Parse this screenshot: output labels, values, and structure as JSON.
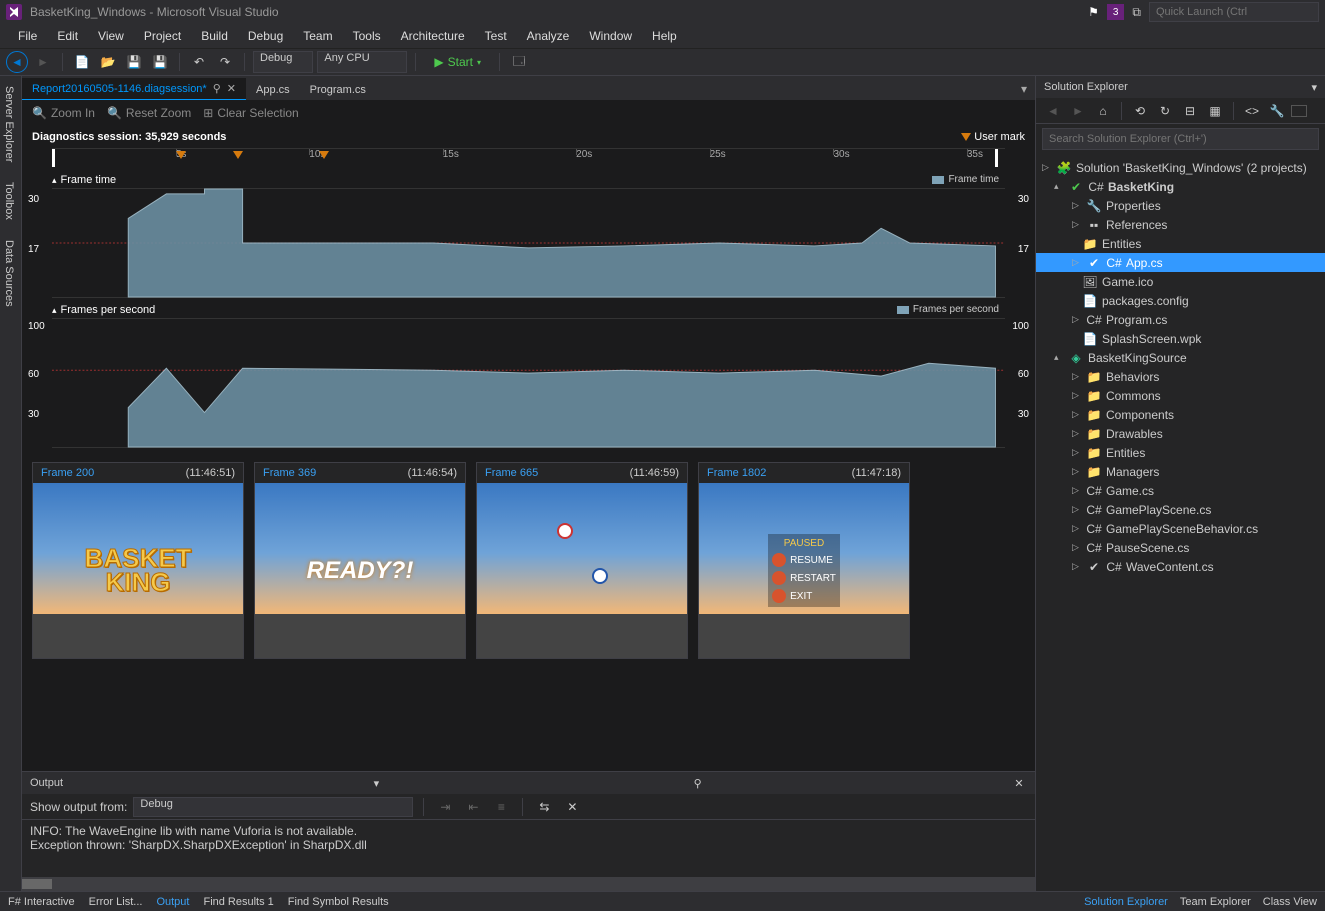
{
  "title": "BasketKing_Windows - Microsoft Visual Studio",
  "notif_count": "3",
  "quicklaunch": "Quick Launch (Ctrl",
  "menu": [
    "File",
    "Edit",
    "View",
    "Project",
    "Build",
    "Debug",
    "Team",
    "Tools",
    "Architecture",
    "Test",
    "Analyze",
    "Window",
    "Help"
  ],
  "toolbar": {
    "config": "Debug",
    "platform": "Any CPU",
    "start": "Start"
  },
  "left_tabs": [
    "Server Explorer",
    "Toolbox",
    "Data Sources"
  ],
  "doc_tabs": [
    {
      "name": "Report20160505-1146.diagsession*",
      "active": true
    },
    {
      "name": "App.cs",
      "active": false
    },
    {
      "name": "Program.cs",
      "active": false
    }
  ],
  "diag": {
    "zoomin": "Zoom In",
    "resetzoom": "Reset Zoom",
    "clearsel": "Clear Selection",
    "session_label": "Diagnostics session: ",
    "session_value": "35,929 seconds",
    "usermark": "User mark",
    "ticks": [
      "5s",
      "10s",
      "15s",
      "20s",
      "25s",
      "30s",
      "35s"
    ]
  },
  "chart_data": [
    {
      "type": "area",
      "title": "Frame time",
      "legend": "Frame time",
      "x": [
        "0s",
        "5s",
        "10s",
        "15s",
        "20s",
        "25s",
        "30s",
        "35s",
        "36s"
      ],
      "values": [
        0,
        20,
        31,
        17,
        17,
        17,
        17,
        17,
        16,
        16,
        16,
        16,
        22,
        17
      ],
      "ylim": [
        0,
        31
      ],
      "yticks": [
        17,
        30
      ]
    },
    {
      "type": "area",
      "title": "Frames per second",
      "legend": "Frames per second",
      "x": [
        "0s",
        "5s",
        "10s",
        "15s",
        "20s",
        "25s",
        "30s",
        "35s",
        "36s"
      ],
      "values": [
        0,
        60,
        30,
        60,
        60,
        60,
        60,
        60,
        58,
        60,
        60,
        58,
        65,
        60
      ],
      "ylim": [
        0,
        110
      ],
      "yticks": [
        30,
        60,
        100
      ],
      "target": 60
    }
  ],
  "thumbs": [
    {
      "frame": "Frame 200",
      "time": "(11:46:51)",
      "kind": "logo"
    },
    {
      "frame": "Frame 369",
      "time": "(11:46:54)",
      "kind": "ready",
      "text": "READY?!"
    },
    {
      "frame": "Frame 665",
      "time": "(11:46:59)",
      "kind": "game"
    },
    {
      "frame": "Frame 1802",
      "time": "(11:47:18)",
      "kind": "pause",
      "menu_title": "PAUSED",
      "items": [
        "RESUME",
        "RESTART",
        "EXIT"
      ]
    }
  ],
  "output": {
    "title": "Output",
    "from_label": "Show output from:",
    "from_value": "Debug",
    "lines": [
      "INFO: The WaveEngine lib with name Vuforia is not available.",
      "Exception thrown: 'SharpDX.SharpDXException' in SharpDX.dll"
    ]
  },
  "sol": {
    "title": "Solution Explorer",
    "search": "Search Solution Explorer (Ctrl+')",
    "root": "Solution 'BasketKing_Windows' (2 projects)",
    "p1": {
      "name": "BasketKing",
      "items": [
        "Properties",
        "References",
        "Entities",
        "App.cs",
        "Game.ico",
        "packages.config",
        "Program.cs",
        "SplashScreen.wpk"
      ]
    },
    "p2": {
      "name": "BasketKingSource",
      "items": [
        "Behaviors",
        "Commons",
        "Components",
        "Drawables",
        "Entities",
        "Managers",
        "Game.cs",
        "GamePlayScene.cs",
        "GamePlaySceneBehavior.cs",
        "PauseScene.cs",
        "WaveContent.cs"
      ]
    }
  },
  "bottom_tabs": [
    "F# Interactive",
    "Error List...",
    "Output",
    "Find Results 1",
    "Find Symbol Results"
  ],
  "bottom_right": [
    "Solution Explorer",
    "Team Explorer",
    "Class View"
  ]
}
